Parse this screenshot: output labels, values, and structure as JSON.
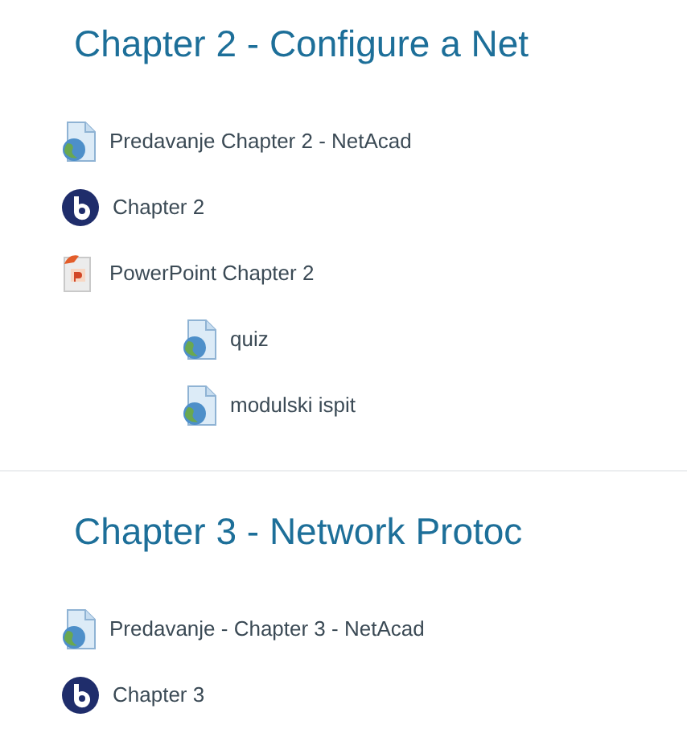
{
  "sections": [
    {
      "title": "Chapter 2 - Configure a Net",
      "activities": [
        {
          "kind": "url",
          "label": "Predavanje Chapter 2 - NetAcad"
        },
        {
          "kind": "bbb",
          "label": "Chapter 2"
        },
        {
          "kind": "powerpoint",
          "label": "PowerPoint Chapter 2",
          "children": [
            {
              "kind": "url",
              "label": "quiz"
            },
            {
              "kind": "url",
              "label": "modulski ispit"
            }
          ]
        }
      ]
    },
    {
      "title": "Chapter 3 - Network Protoc",
      "activities": [
        {
          "kind": "url",
          "label": "Predavanje - Chapter 3 - NetAcad"
        },
        {
          "kind": "bbb",
          "label": "Chapter 3"
        }
      ]
    }
  ]
}
